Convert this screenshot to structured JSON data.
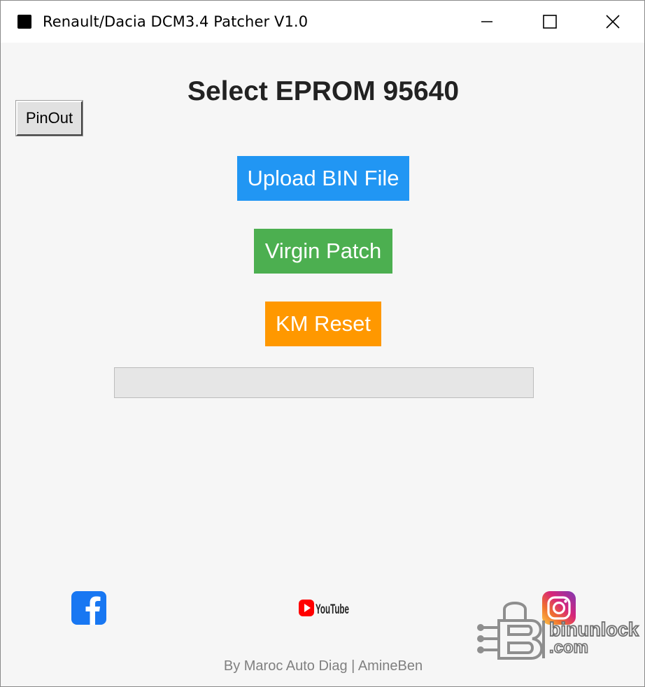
{
  "window": {
    "title": "Renault/Dacia DCM3.4 Patcher V1.0",
    "minimize_icon": "minimize-icon",
    "maximize_icon": "maximize-icon",
    "close_icon": "close-icon"
  },
  "main": {
    "pinout_label": "PinOut",
    "heading": "Select EPROM 95640",
    "upload_label": "Upload BIN File",
    "virgin_label": "Virgin Patch",
    "km_reset_label": "KM Reset",
    "progress": 0
  },
  "social": {
    "facebook_icon": "facebook-icon",
    "youtube_icon": "youtube-icon",
    "instagram_icon": "instagram-icon"
  },
  "watermark": {
    "text_top": "binunlock",
    "text_bottom": ".com"
  },
  "footer": {
    "credit": "By Maroc Auto Diag | AmineBen"
  },
  "colors": {
    "upload": "#2196f3",
    "virgin": "#4caf50",
    "km_reset": "#ff9800",
    "background": "#f6f6f6"
  }
}
